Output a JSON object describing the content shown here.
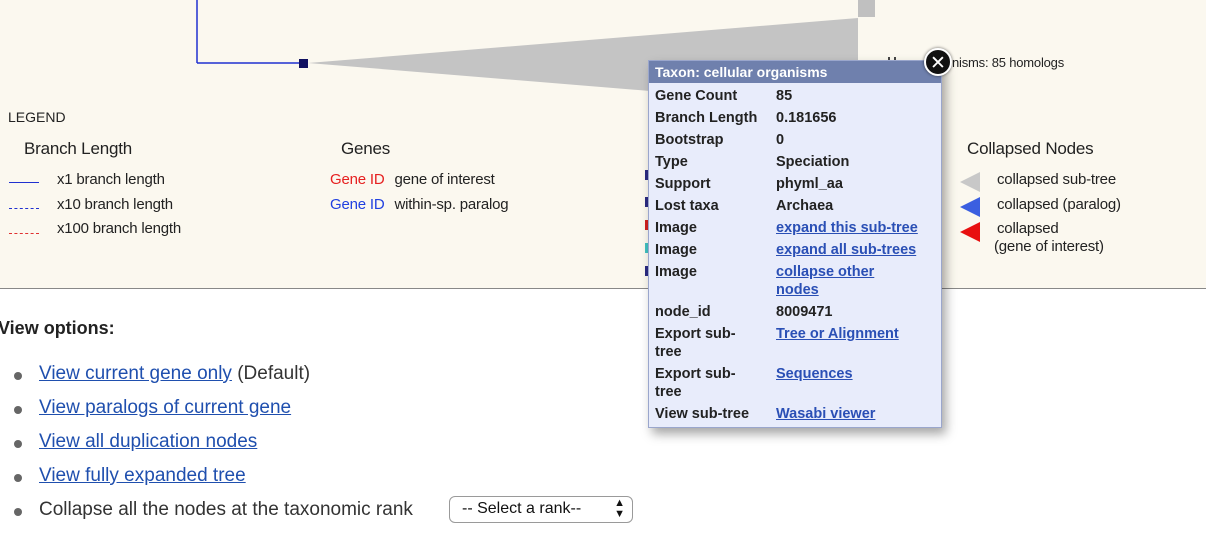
{
  "tree": {
    "collapsed_caption": "nisms: 85 homologs"
  },
  "legend": {
    "title": "LEGEND",
    "branch_length": {
      "heading": "Branch Length",
      "items": [
        {
          "label": "x1 branch length",
          "color": "#2030d0"
        },
        {
          "label": "x10 branch length",
          "color": "#2030d0"
        },
        {
          "label": "x100 branch length",
          "color": "#e03030"
        }
      ]
    },
    "genes": {
      "heading": "Genes",
      "items": [
        {
          "id_label": "Gene ID",
          "desc": "gene of interest",
          "color": "#e62020"
        },
        {
          "id_label": "Gene ID",
          "desc": "within-sp. paralog",
          "color": "#2040e0"
        }
      ]
    },
    "collapsed_nodes": {
      "heading": "Collapsed Nodes",
      "items": [
        {
          "label": "collapsed sub-tree",
          "color": "#c8c8c8"
        },
        {
          "label": "collapsed (paralog)",
          "color": "#3b5fe0"
        },
        {
          "label_line1": "collapsed",
          "label_line2": "(gene of interest)",
          "color": "#e81010"
        }
      ]
    }
  },
  "popup": {
    "title": "Taxon: cellular organisms",
    "close_icon": "close-icon",
    "rows": [
      {
        "key": "Gene Count",
        "value": "85"
      },
      {
        "key": "Branch Length",
        "value": "0.181656"
      },
      {
        "key": "Bootstrap",
        "value": "0"
      },
      {
        "key": "Type",
        "value": "Speciation"
      },
      {
        "key": "Support",
        "value": "phyml_aa"
      },
      {
        "key": "Lost taxa",
        "value": "Archaea"
      },
      {
        "key": "Image",
        "link": "expand this sub-tree"
      },
      {
        "key": "Image",
        "link": "expand all sub-trees"
      },
      {
        "key": "Image",
        "link_line1": "collapse other",
        "link_line2": "nodes"
      },
      {
        "key": "node_id",
        "value": "8009471"
      },
      {
        "key_line1": "Export sub-",
        "key_line2": "tree",
        "link": "Tree or Alignment"
      },
      {
        "key_line1": "Export sub-",
        "key_line2": "tree",
        "link": "Sequences"
      },
      {
        "key": "View sub-tree",
        "link": "Wasabi viewer"
      }
    ]
  },
  "view_options": {
    "title": "View options:",
    "items": [
      {
        "link": "View current gene only",
        "suffix": " (Default)"
      },
      {
        "link": "View paralogs of current gene"
      },
      {
        "link": "View all duplication nodes"
      },
      {
        "link": "View fully expanded tree"
      },
      {
        "text": "Collapse all the nodes at the taxonomic rank"
      }
    ],
    "rank_select": {
      "selected": "-- Select a rank--",
      "arrows_icon": "updown-arrows-icon"
    }
  }
}
